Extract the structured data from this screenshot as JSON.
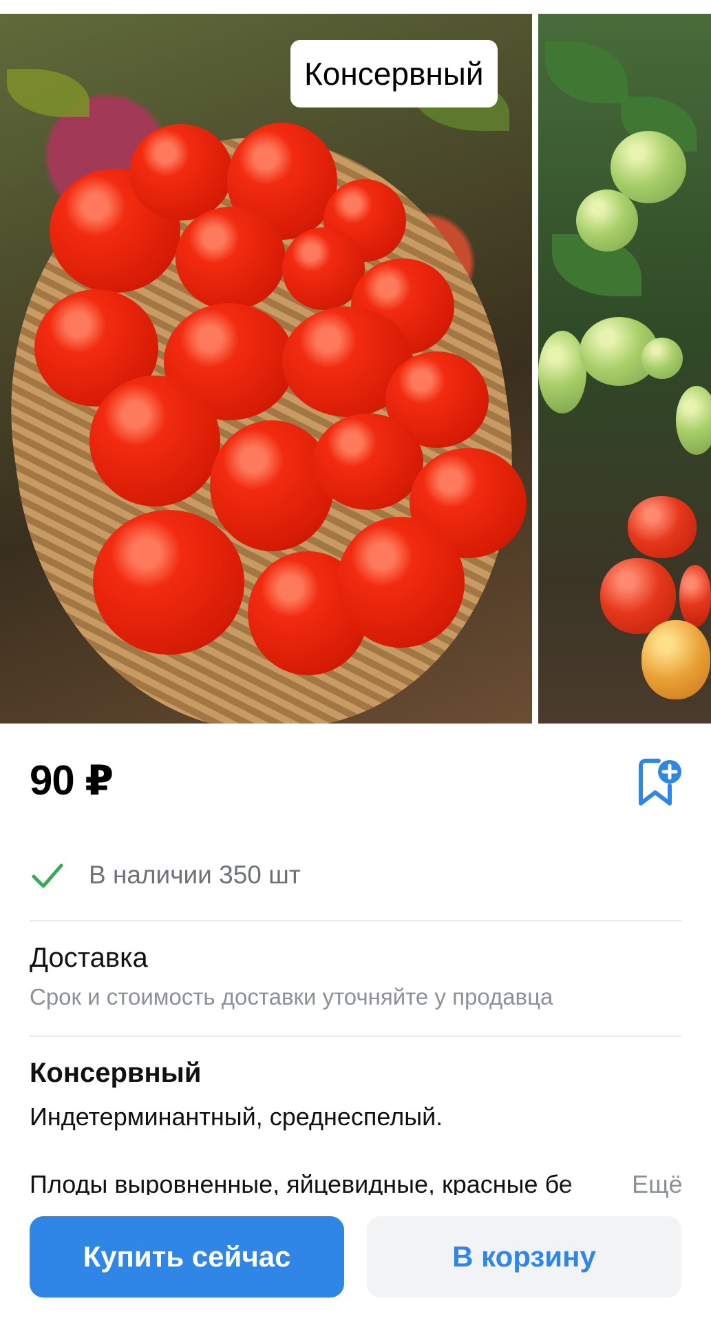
{
  "gallery": {
    "title_tag": "Консервный"
  },
  "product": {
    "price": "90 ₽",
    "stock": "В наличии 350 шт",
    "delivery_title": "Доставка",
    "delivery_subtitle": "Срок и стоимость доставки уточняйте у продавца",
    "description_title": "Консервный",
    "description_line1": "Индетерминантный, среднеспелый.",
    "description_line2": "Плоды выровненные, яйцевидные, красные бе",
    "more_label": "Ещё"
  },
  "actions": {
    "buy_now": "Купить сейчас",
    "add_to_cart": "В корзину"
  },
  "icons": {
    "bookmark": "bookmark-add-icon",
    "stock_check": "check-icon"
  },
  "colors": {
    "accent": "#2f86e6",
    "check": "#3aa85c"
  }
}
